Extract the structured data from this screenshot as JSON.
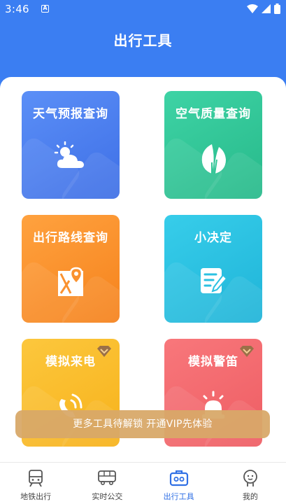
{
  "status_bar": {
    "time": "3:46",
    "notification_icon": "A"
  },
  "header": {
    "title": "出行工具"
  },
  "cards": [
    {
      "label": "天气预报查询",
      "icon": "weather-icon",
      "color": "#4a80ef",
      "premium": false
    },
    {
      "label": "空气质量查询",
      "icon": "leaf-icon",
      "color": "#2fc696",
      "premium": false
    },
    {
      "label": "出行路线查询",
      "icon": "map-icon",
      "color": "#fa9230",
      "premium": false
    },
    {
      "label": "小决定",
      "icon": "note-icon",
      "color": "#2bc1e2",
      "premium": false
    },
    {
      "label": "模拟来电",
      "icon": "phone-icon",
      "color": "#f9bd2c",
      "premium": true
    },
    {
      "label": "模拟警笛",
      "icon": "siren-icon",
      "color": "#f36a6f",
      "premium": true
    }
  ],
  "toast": {
    "text": "更多工具待解锁 开通VIP先体验"
  },
  "bottom_nav": {
    "items": [
      {
        "label": "地铁出行",
        "icon": "subway-icon",
        "active": false
      },
      {
        "label": "实时公交",
        "icon": "bus-icon",
        "active": false
      },
      {
        "label": "出行工具",
        "icon": "toolbox-icon",
        "active": true
      },
      {
        "label": "我的",
        "icon": "profile-icon",
        "active": false
      }
    ]
  }
}
